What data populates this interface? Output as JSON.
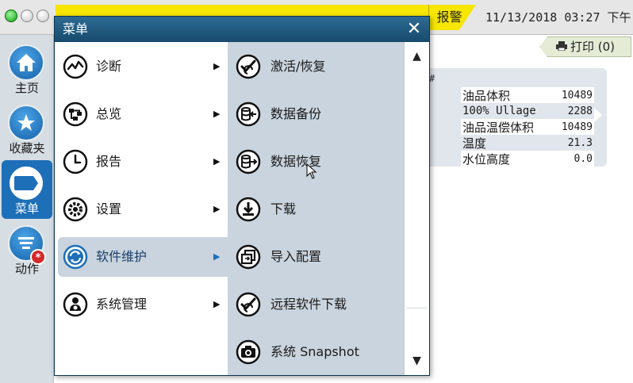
{
  "topbar": {
    "alarm_label": "报警",
    "datetime": "11/13/2018 03:27 下午"
  },
  "leftnav": {
    "items": [
      {
        "label": "主页",
        "icon": "home-icon"
      },
      {
        "label": "收藏夹",
        "icon": "star-icon"
      },
      {
        "label": "菜单",
        "icon": "menu-icon",
        "active": true
      },
      {
        "label": "动作",
        "icon": "actions-icon",
        "badge": "*"
      }
    ]
  },
  "background": {
    "print_label": "打印 (0)",
    "hash": "#",
    "tank": {
      "rows": [
        {
          "label": "油品体积",
          "value": "10489"
        },
        {
          "label": "100% Ullage",
          "value": "2288"
        },
        {
          "label": "油品温偿体积",
          "value": "10489"
        },
        {
          "label": "温度",
          "value": "21.3"
        },
        {
          "label": "水位高度",
          "value": "0.0"
        }
      ]
    }
  },
  "menu": {
    "title": "菜单",
    "close_symbol": "✕",
    "items": [
      {
        "label": "诊断",
        "icon": "diagnostics-icon"
      },
      {
        "label": "总览",
        "icon": "overview-icon"
      },
      {
        "label": "报告",
        "icon": "report-clock-icon"
      },
      {
        "label": "设置",
        "icon": "settings-gear-icon"
      },
      {
        "label": "软件维护",
        "icon": "software-maintenance-icon",
        "selected": true
      },
      {
        "label": "系统管理",
        "icon": "system-admin-icon"
      }
    ],
    "submenu": [
      {
        "label": "激活/恢复",
        "icon": "activate-restore-icon"
      },
      {
        "label": "数据备份",
        "icon": "data-backup-icon"
      },
      {
        "label": "数据恢复",
        "icon": "data-restore-icon"
      },
      {
        "label": "下载",
        "icon": "download-icon"
      },
      {
        "label": "导入配置",
        "icon": "import-config-icon"
      },
      {
        "label": "远程软件下载",
        "icon": "remote-download-icon"
      },
      {
        "label": "系统 Snapshot",
        "icon": "camera-icon"
      }
    ]
  },
  "colors": {
    "accent": "#1d6fb8",
    "header": "#174a6d",
    "alarm": "#f7e600",
    "submenu_bg": "#c9d4de"
  }
}
